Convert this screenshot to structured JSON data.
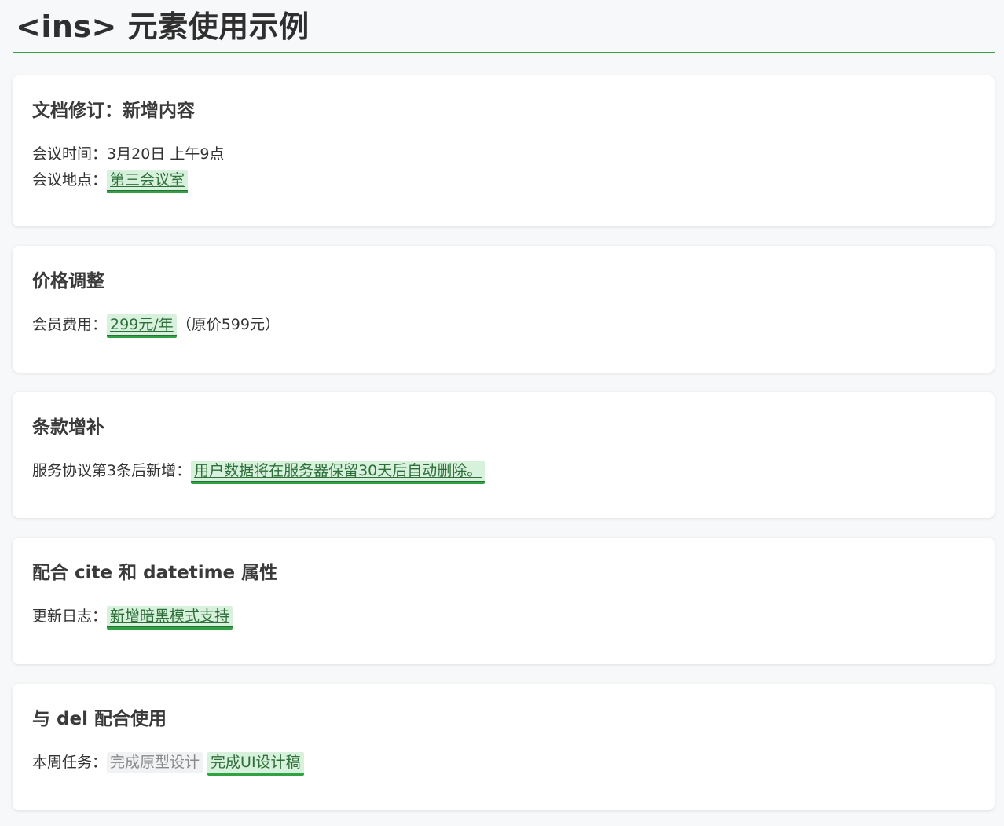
{
  "page": {
    "title": "<ins> 元素使用示例"
  },
  "cards": [
    {
      "title": "文档修订：新增内容",
      "lines": [
        {
          "label": "会议时间：",
          "text": "3月20日 上午9点"
        },
        {
          "label": "会议地点：",
          "inserted": "第三会议室"
        }
      ]
    },
    {
      "title": "价格调整",
      "lines": [
        {
          "label": "会员费用：",
          "inserted": "299元/年",
          "after": "（原价599元）"
        }
      ]
    },
    {
      "title": "条款增补",
      "lines": [
        {
          "label": "服务协议第3条后新增：",
          "inserted": "用户数据将在服务器保留30天后自动删除。"
        }
      ]
    },
    {
      "title": "配合 cite 和 datetime 属性",
      "lines": [
        {
          "label": "更新日志：",
          "inserted": "新增暗黑模式支持"
        }
      ]
    },
    {
      "title": "与 del 配合使用",
      "lines": [
        {
          "label": "本周任务：",
          "deleted": "完成原型设计",
          "inserted": "完成UI设计稿"
        }
      ]
    }
  ],
  "colors": {
    "accent": "#34a04a",
    "inserted_bg": "#d7f1dc",
    "inserted_text": "#2e6e3a",
    "deleted_text": "#8a8a8a"
  }
}
